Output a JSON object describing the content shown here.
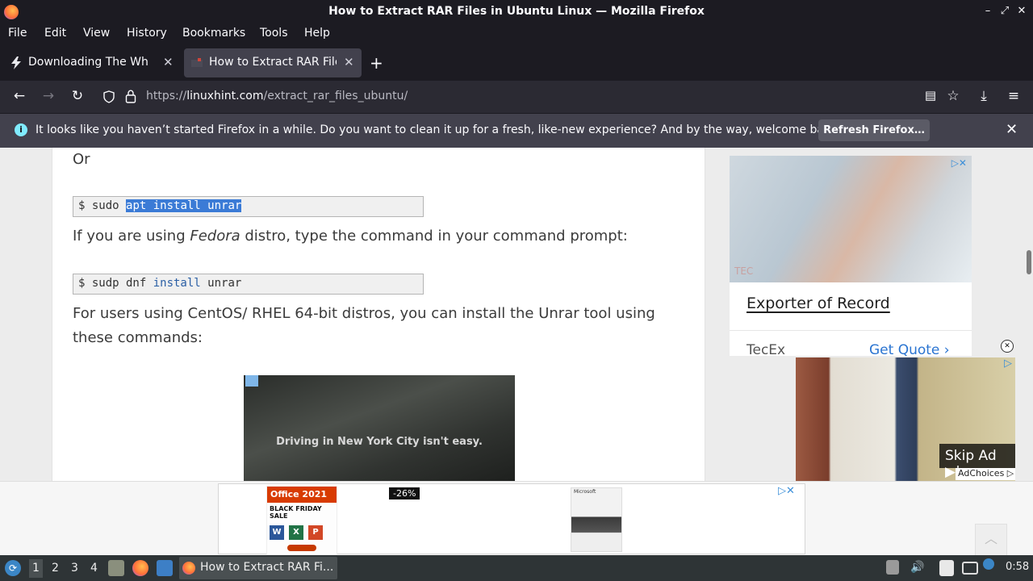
{
  "window": {
    "title": "How to Extract RAR Files in Ubuntu Linux — Mozilla Firefox",
    "minimize": "–",
    "maximize": "⤢",
    "close": "✕"
  },
  "menu": {
    "items": [
      "File",
      "Edit",
      "View",
      "History",
      "Bookmarks",
      "Tools",
      "Help"
    ]
  },
  "tabs": [
    {
      "label": "Downloading The White F",
      "close": "✕"
    },
    {
      "label": "How to Extract RAR Files",
      "close": "✕"
    }
  ],
  "new_tab": "+",
  "nav": {
    "back": "←",
    "forward": "→",
    "reload": "↻",
    "url_prefix": "https://",
    "url_domain": "linuxhint.com",
    "url_path": "/extract_rar_files_ubuntu/",
    "reader": "▤",
    "bookmark": "☆",
    "downloads": "⤓",
    "menu": "≡"
  },
  "notification": {
    "icon": "i",
    "message": "It looks like you haven’t started Firefox in a while. Do you want to clean it up for a fresh, like-new experience? And by the way, welcome back!",
    "button": "Refresh Firefox…",
    "close": "✕"
  },
  "article": {
    "or_text": "Or",
    "code1": {
      "prompt": "$ sudo ",
      "selected": "apt install unrar"
    },
    "para1_before": "If you are using ",
    "para1_em": "Fedora",
    "para1_after": " distro, type the command in your command prompt:",
    "code2": {
      "prompt": "$ sudp dnf ",
      "kw": "install",
      "rest": " unrar"
    },
    "para2_line1": "For users using CentOS/ RHEL 64-bit distros, you can install the Unrar tool using",
    "para2_line2": "these commands:",
    "video_ad_text": "Driving in New York City isn't easy."
  },
  "side_ad": {
    "tag": "▷✕",
    "logo": "TEC",
    "headline": "Exporter of Record",
    "brand": "TecEx",
    "cta": "Get Quote ›"
  },
  "float_ad": {
    "close": "✕",
    "tag": "▷",
    "skip": "Skip Ad ▶|",
    "adchoices": "AdChoices ▷"
  },
  "bottom_ad": {
    "office_title": "Office 2021",
    "sale": "BLACK FRIDAY SALE",
    "apps": [
      "W",
      "X",
      "P"
    ],
    "discount": "-26%",
    "ms_label": "Microsoft",
    "tag": "▷✕",
    "scroll_up": "︿"
  },
  "taskbar": {
    "workspaces": [
      "1",
      "2",
      "3",
      "4"
    ],
    "active_task": "How to Extract RAR Fi...",
    "clock": "0:58"
  }
}
